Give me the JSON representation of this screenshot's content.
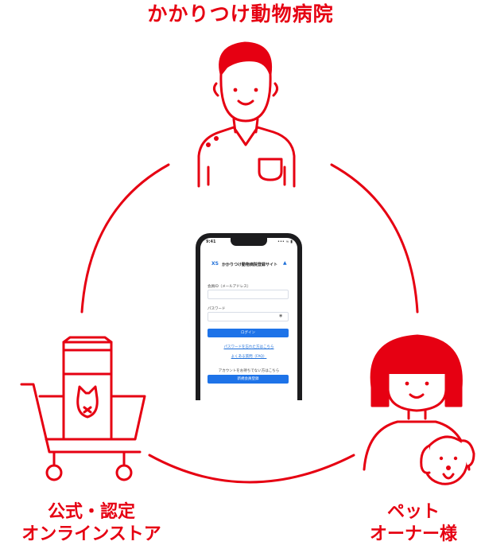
{
  "labels": {
    "top": "かかりつけ動物病院",
    "left_line1": "公式・認定",
    "left_line2": "オンラインストア",
    "right_line1": "ペット",
    "right_line2": "オーナー様"
  },
  "phone": {
    "time": "9:41",
    "status_icons": "••• ≈ ▮",
    "logo": "XS",
    "site_title": "かかりつけ動物病院登録サイト",
    "member_id_label": "会員ID（メールアドレス）",
    "password_label": "パスワード",
    "login_button": "ログイン",
    "forgot_password_link": "パスワードを忘れた方はこちら",
    "faq_link": "よくある質問（FAQ）",
    "no_account_text": "アカウントをお持ちでない方はこちら",
    "register_button": "新規会員登録"
  },
  "colors": {
    "accent": "#e60012",
    "button_blue": "#1e73e8"
  },
  "icons": [
    "veterinarian-icon",
    "pet-owner-icon",
    "dog-icon",
    "shopping-cart-icon",
    "pet-food-bag-icon",
    "eye-icon"
  ]
}
